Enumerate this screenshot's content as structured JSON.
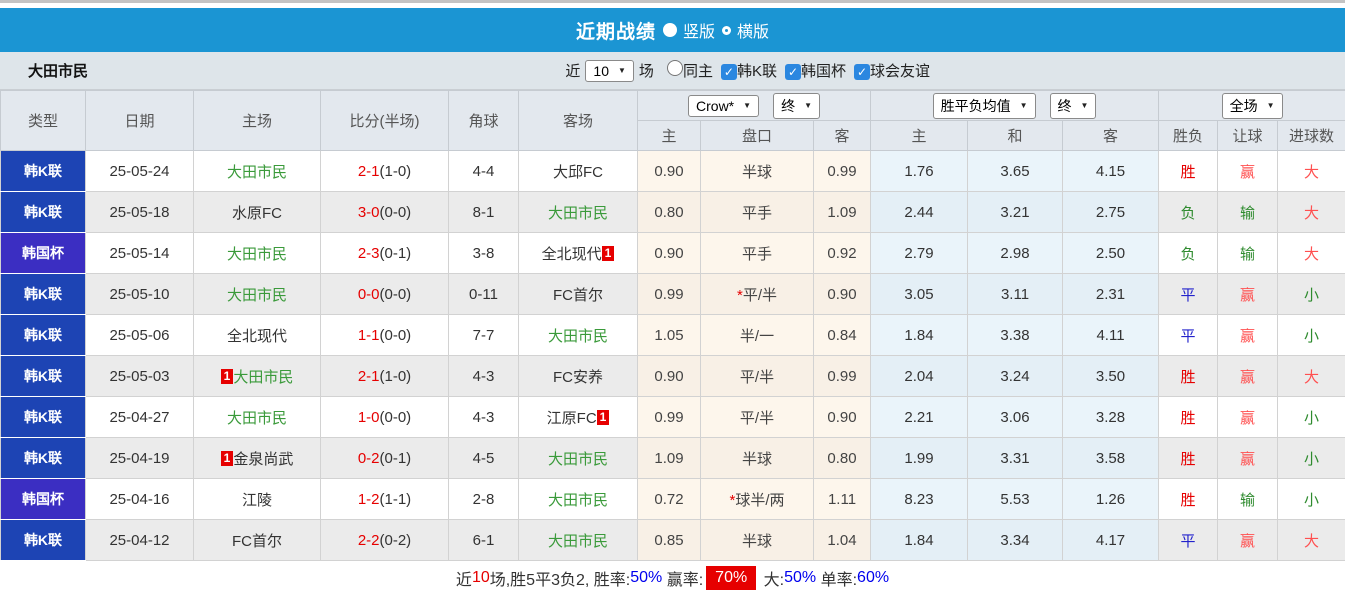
{
  "title_bar": {
    "title": "近期战绩",
    "vertical_label": "竖版",
    "horizontal_label": "横版"
  },
  "filter_bar": {
    "team_name": "大田市民",
    "near_label": "近",
    "count_value": "10",
    "games_label": "场",
    "checkboxes": [
      {
        "label": "同主",
        "checked": false
      },
      {
        "label": "韩K联",
        "checked": true
      },
      {
        "label": "韩国杯",
        "checked": true
      },
      {
        "label": "球会友谊",
        "checked": true
      }
    ]
  },
  "table": {
    "left_headers": [
      "类型",
      "日期",
      "主场",
      "比分(半场)",
      "角球",
      "客场"
    ],
    "asia": {
      "bookmaker_select": "Crow*",
      "final_select": "终",
      "sub": [
        "主",
        "盘口",
        "客"
      ]
    },
    "europe": {
      "bookmaker_select": "胜平负均值",
      "final_select": "终",
      "sub": [
        "主",
        "和",
        "客"
      ]
    },
    "result": {
      "scope_select": "全场",
      "sub": [
        "胜负",
        "让球",
        "进球数"
      ]
    },
    "badge_label": "1",
    "rows": [
      {
        "type": {
          "text": "韩K联",
          "cls": "kleague"
        },
        "date": "25-05-24",
        "home": {
          "name": "大田市民",
          "green": true,
          "badge": null
        },
        "score": {
          "ft": "2-1",
          "ht": "(1-0)"
        },
        "corner": "4-4",
        "away": {
          "name": "大邱FC",
          "green": false,
          "badge": null
        },
        "asia": {
          "home": "0.90",
          "handicap": "半球",
          "star": false,
          "away": "0.99"
        },
        "europe": {
          "home": "1.76",
          "draw": "3.65",
          "away": "4.15"
        },
        "result": {
          "outcome": {
            "text": "胜",
            "cls": "c-red"
          },
          "handicap": {
            "text": "赢",
            "cls": "c-red2"
          },
          "goals": {
            "text": "大",
            "cls": "c-red2"
          }
        }
      },
      {
        "type": {
          "text": "韩K联",
          "cls": "kleague"
        },
        "date": "25-05-18",
        "home": {
          "name": "水原FC",
          "green": false,
          "badge": null
        },
        "score": {
          "ft": "3-0",
          "ht": "(0-0)"
        },
        "corner": "8-1",
        "away": {
          "name": "大田市民",
          "green": true,
          "badge": null
        },
        "asia": {
          "home": "0.80",
          "handicap": "平手",
          "star": false,
          "away": "1.09"
        },
        "europe": {
          "home": "2.44",
          "draw": "3.21",
          "away": "2.75"
        },
        "result": {
          "outcome": {
            "text": "负",
            "cls": "c-green"
          },
          "handicap": {
            "text": "输",
            "cls": "c-green"
          },
          "goals": {
            "text": "大",
            "cls": "c-red2"
          }
        }
      },
      {
        "type": {
          "text": "韩国杯",
          "cls": "kcup"
        },
        "date": "25-05-14",
        "home": {
          "name": "大田市民",
          "green": true,
          "badge": null
        },
        "score": {
          "ft": "2-3",
          "ht": "(0-1)"
        },
        "corner": "3-8",
        "away": {
          "name": "全北现代",
          "green": false,
          "badge": "after"
        },
        "asia": {
          "home": "0.90",
          "handicap": "平手",
          "star": false,
          "away": "0.92"
        },
        "europe": {
          "home": "2.79",
          "draw": "2.98",
          "away": "2.50"
        },
        "result": {
          "outcome": {
            "text": "负",
            "cls": "c-green"
          },
          "handicap": {
            "text": "输",
            "cls": "c-green"
          },
          "goals": {
            "text": "大",
            "cls": "c-red2"
          }
        }
      },
      {
        "type": {
          "text": "韩K联",
          "cls": "kleague"
        },
        "date": "25-05-10",
        "home": {
          "name": "大田市民",
          "green": true,
          "badge": null
        },
        "score": {
          "ft": "0-0",
          "ht": "(0-0)"
        },
        "corner": "0-11",
        "away": {
          "name": "FC首尔",
          "green": false,
          "badge": null
        },
        "asia": {
          "home": "0.99",
          "handicap": "平/半",
          "star": true,
          "away": "0.90"
        },
        "europe": {
          "home": "3.05",
          "draw": "3.11",
          "away": "2.31"
        },
        "result": {
          "outcome": {
            "text": "平",
            "cls": "c-blue"
          },
          "handicap": {
            "text": "赢",
            "cls": "c-red2"
          },
          "goals": {
            "text": "小",
            "cls": "c-green"
          }
        }
      },
      {
        "type": {
          "text": "韩K联",
          "cls": "kleague"
        },
        "date": "25-05-06",
        "home": {
          "name": "全北现代",
          "green": false,
          "badge": null
        },
        "score": {
          "ft": "1-1",
          "ht": "(0-0)"
        },
        "corner": "7-7",
        "away": {
          "name": "大田市民",
          "green": true,
          "badge": null
        },
        "asia": {
          "home": "1.05",
          "handicap": "半/一",
          "star": false,
          "away": "0.84"
        },
        "europe": {
          "home": "1.84",
          "draw": "3.38",
          "away": "4.11"
        },
        "result": {
          "outcome": {
            "text": "平",
            "cls": "c-blue"
          },
          "handicap": {
            "text": "赢",
            "cls": "c-red2"
          },
          "goals": {
            "text": "小",
            "cls": "c-green"
          }
        }
      },
      {
        "type": {
          "text": "韩K联",
          "cls": "kleague"
        },
        "date": "25-05-03",
        "home": {
          "name": "大田市民",
          "green": true,
          "badge": "before"
        },
        "score": {
          "ft": "2-1",
          "ht": "(1-0)"
        },
        "corner": "4-3",
        "away": {
          "name": "FC安养",
          "green": false,
          "badge": null
        },
        "asia": {
          "home": "0.90",
          "handicap": "平/半",
          "star": false,
          "away": "0.99"
        },
        "europe": {
          "home": "2.04",
          "draw": "3.24",
          "away": "3.50"
        },
        "result": {
          "outcome": {
            "text": "胜",
            "cls": "c-red"
          },
          "handicap": {
            "text": "赢",
            "cls": "c-red2"
          },
          "goals": {
            "text": "大",
            "cls": "c-red2"
          }
        }
      },
      {
        "type": {
          "text": "韩K联",
          "cls": "kleague"
        },
        "date": "25-04-27",
        "home": {
          "name": "大田市民",
          "green": true,
          "badge": null
        },
        "score": {
          "ft": "1-0",
          "ht": "(0-0)"
        },
        "corner": "4-3",
        "away": {
          "name": "江原FC",
          "green": false,
          "badge": "after"
        },
        "asia": {
          "home": "0.99",
          "handicap": "平/半",
          "star": false,
          "away": "0.90"
        },
        "europe": {
          "home": "2.21",
          "draw": "3.06",
          "away": "3.28"
        },
        "result": {
          "outcome": {
            "text": "胜",
            "cls": "c-red"
          },
          "handicap": {
            "text": "赢",
            "cls": "c-red2"
          },
          "goals": {
            "text": "小",
            "cls": "c-green"
          }
        }
      },
      {
        "type": {
          "text": "韩K联",
          "cls": "kleague"
        },
        "date": "25-04-19",
        "home": {
          "name": "金泉尚武",
          "green": false,
          "badge": "before"
        },
        "score": {
          "ft": "0-2",
          "ht": "(0-1)"
        },
        "corner": "4-5",
        "away": {
          "name": "大田市民",
          "green": true,
          "badge": null
        },
        "asia": {
          "home": "1.09",
          "handicap": "半球",
          "star": false,
          "away": "0.80"
        },
        "europe": {
          "home": "1.99",
          "draw": "3.31",
          "away": "3.58"
        },
        "result": {
          "outcome": {
            "text": "胜",
            "cls": "c-red"
          },
          "handicap": {
            "text": "赢",
            "cls": "c-red2"
          },
          "goals": {
            "text": "小",
            "cls": "c-green"
          }
        }
      },
      {
        "type": {
          "text": "韩国杯",
          "cls": "kcup"
        },
        "date": "25-04-16",
        "home": {
          "name": "江陵",
          "green": false,
          "badge": null
        },
        "score": {
          "ft": "1-2",
          "ht": "(1-1)"
        },
        "corner": "2-8",
        "away": {
          "name": "大田市民",
          "green": true,
          "badge": null
        },
        "asia": {
          "home": "0.72",
          "handicap": "球半/两",
          "star": true,
          "away": "1.11"
        },
        "europe": {
          "home": "8.23",
          "draw": "5.53",
          "away": "1.26"
        },
        "result": {
          "outcome": {
            "text": "胜",
            "cls": "c-red"
          },
          "handicap": {
            "text": "输",
            "cls": "c-green"
          },
          "goals": {
            "text": "小",
            "cls": "c-green"
          }
        }
      },
      {
        "type": {
          "text": "韩K联",
          "cls": "kleague"
        },
        "date": "25-04-12",
        "home": {
          "name": "FC首尔",
          "green": false,
          "badge": null
        },
        "score": {
          "ft": "2-2",
          "ht": "(0-2)"
        },
        "corner": "6-1",
        "away": {
          "name": "大田市民",
          "green": true,
          "badge": null
        },
        "asia": {
          "home": "0.85",
          "handicap": "半球",
          "star": false,
          "away": "1.04"
        },
        "europe": {
          "home": "1.84",
          "draw": "3.34",
          "away": "4.17"
        },
        "result": {
          "outcome": {
            "text": "平",
            "cls": "c-blue"
          },
          "handicap": {
            "text": "赢",
            "cls": "c-red2"
          },
          "goals": {
            "text": "大",
            "cls": "c-red2"
          }
        }
      }
    ]
  },
  "summary": {
    "segments": [
      {
        "text": "近",
        "cls": "seg-black"
      },
      {
        "text": "10",
        "cls": "seg-red"
      },
      {
        "text": "场,胜5平3负2, ",
        "cls": "seg-black"
      },
      {
        "text": "胜率:",
        "cls": "seg-black"
      },
      {
        "text": "50%",
        "cls": "seg-blue"
      },
      {
        "text": " 赢率:",
        "cls": "seg-black"
      },
      {
        "text": "70%",
        "cls": "seg-redbg"
      },
      {
        "text": " 大:",
        "cls": "seg-black"
      },
      {
        "text": "50%",
        "cls": "seg-blue"
      },
      {
        "text": " 单率:",
        "cls": "seg-black"
      },
      {
        "text": "60%",
        "cls": "seg-blue"
      }
    ]
  },
  "colors": {
    "accent_blue": "#1b95d3",
    "kleague_blue": "#1d44b4",
    "kcup_indigo": "#3b2ec2",
    "team_green": "#3a9a3a",
    "score_red": "#e60000",
    "draw_blue": "#2222cc",
    "lose_green": "#2e8b2e",
    "asia_col_bg": "#fdf6ec",
    "euro_col_bg": "#eaf4fa",
    "checkbox_blue": "#2b87e0"
  }
}
